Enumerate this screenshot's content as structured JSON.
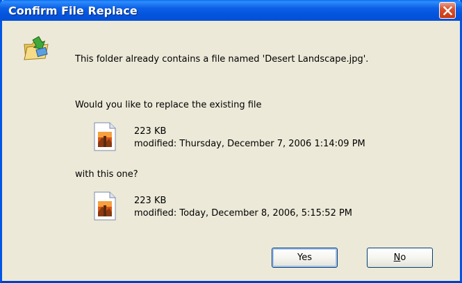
{
  "window": {
    "title": "Confirm File Replace"
  },
  "icons": {
    "close": "close-icon",
    "folder": "folder-replace-icon",
    "file": "image-file-icon"
  },
  "dialog": {
    "message": "This folder already contains a file named 'Desert Landscape.jpg'.",
    "question_existing": "Would you like to replace the existing file",
    "existing_file": {
      "size": "223 KB",
      "modified": "modified: Thursday, December 7, 2006 1:14:09 PM"
    },
    "question_new": "with this one?",
    "new_file": {
      "size": "223 KB",
      "modified": "modified: Today, December 8, 2006, 5:15:52 PM"
    }
  },
  "buttons": {
    "yes": "Yes",
    "no_prefix": "N",
    "no_rest": "o"
  },
  "colors": {
    "titlebar": "#0454dc",
    "close_button": "#d8522e",
    "window_bg": "#ece9d8"
  }
}
